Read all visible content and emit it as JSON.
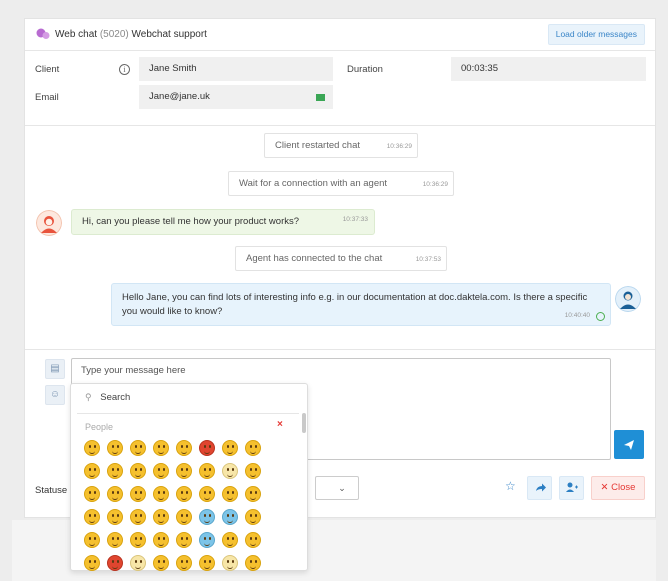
{
  "header": {
    "title_prefix": "Web chat",
    "title_id": "(5020)",
    "title_queue": "Webchat support",
    "load_older_label": "Load older messages"
  },
  "details": {
    "client_label": "Client",
    "client_value": "Jane Smith",
    "duration_label": "Duration",
    "duration_value": "00:03:35",
    "email_label": "Email",
    "email_value": "Jane@jane.uk"
  },
  "messages": [
    {
      "type": "system",
      "text": "Client restarted chat",
      "time": "10:36:29"
    },
    {
      "type": "system",
      "text": "Wait for a connection with an agent",
      "time": "10:36:29"
    },
    {
      "type": "client",
      "text": "Hi, can you please tell me how your product works?",
      "time": "10:37:33"
    },
    {
      "type": "system",
      "text": "Agent has connected to the chat",
      "time": "10:37:53"
    },
    {
      "type": "agent",
      "text": "Hello Jane, you can find lots of interesting info e.g. in our documentation at doc.daktela.com. Is there a specific you would like to know?",
      "time": "10:40:40"
    }
  ],
  "composer": {
    "placeholder": "Type your message here",
    "statuses_label": "Statuse",
    "close_label": "Close"
  },
  "emoji_picker": {
    "search_label": "Search",
    "category": "People",
    "rows": 6,
    "cols": 8
  },
  "colors": {
    "accent": "#1f8fd6",
    "client_bubble": "#eef7e6",
    "agent_bubble": "#e7f3fc",
    "close_red": "#e53935"
  }
}
